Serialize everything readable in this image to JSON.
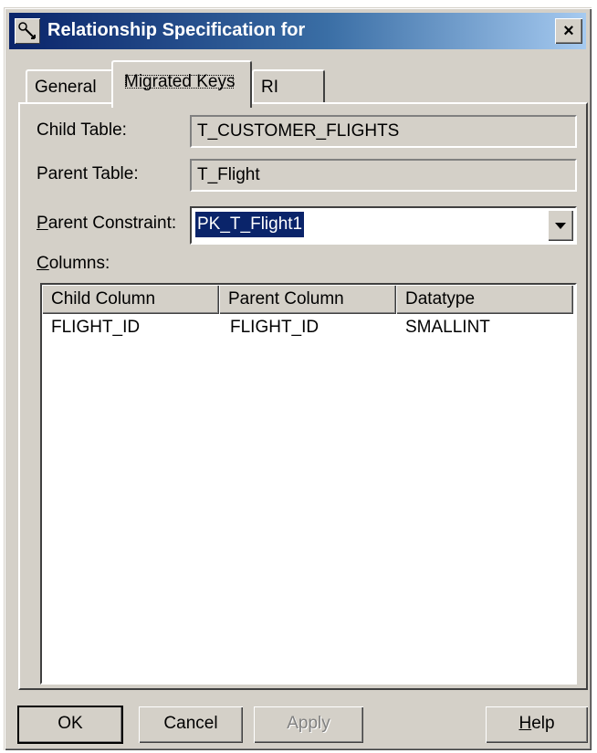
{
  "window": {
    "title": "Relationship Specification for",
    "close_glyph": "×",
    "icon": "relationship-tool-icon"
  },
  "tabs": [
    {
      "label": "General",
      "selected": false
    },
    {
      "label": "Migrated Keys",
      "selected": true
    },
    {
      "label": "RI",
      "selected": false
    }
  ],
  "form": {
    "child_table_label": "Child Table:",
    "child_table_value": "T_CUSTOMER_FLIGHTS",
    "parent_table_label": "Parent Table:",
    "parent_table_value": "T_Flight",
    "parent_constraint_label_rest": "arent Constraint:",
    "parent_constraint_label_mnemonic": "P",
    "parent_constraint_value": "PK_T_Flight1",
    "columns_label_mnemonic": "C",
    "columns_label_rest": "olumns:"
  },
  "columns_table": {
    "headers": [
      "Child Column",
      "Parent Column",
      "Datatype"
    ],
    "rows": [
      [
        "FLIGHT_ID",
        "FLIGHT_ID",
        "SMALLINT"
      ]
    ]
  },
  "buttons": {
    "ok": "OK",
    "cancel": "Cancel",
    "apply": "Apply",
    "help_mnemonic": "H",
    "help_rest": "elp"
  },
  "colors": {
    "dialog_face": "#d4d0c8",
    "titlebar_start": "#0a246a",
    "titlebar_end": "#a6caf0",
    "selection": "#0a246a"
  }
}
